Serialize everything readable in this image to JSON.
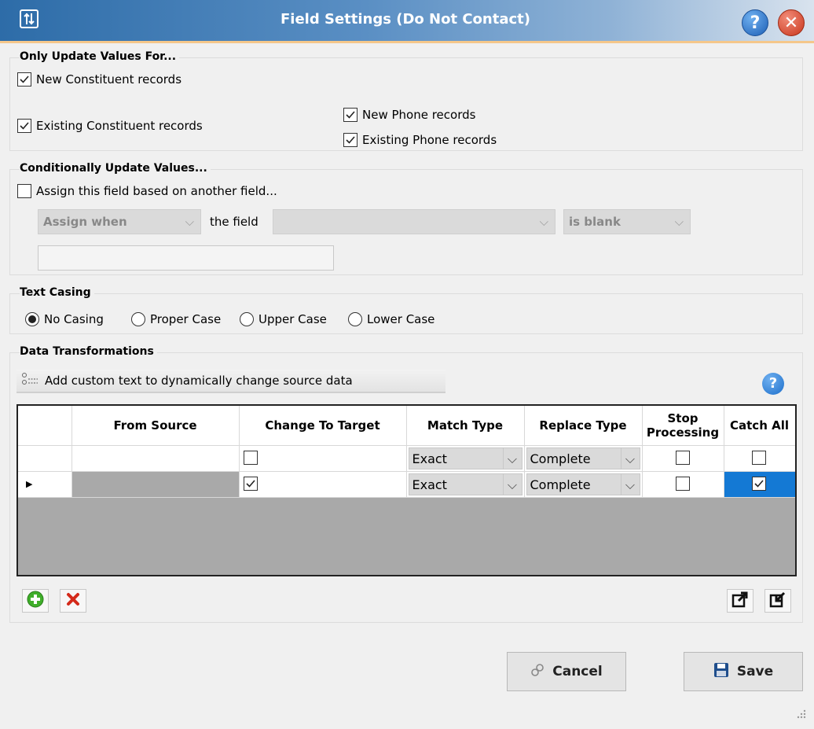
{
  "window": {
    "title": "Field Settings (Do Not Contact)",
    "help_glyph": "?",
    "close_glyph": "✕"
  },
  "update_values": {
    "title": "Only Update Values For...",
    "new_constituent": {
      "label": "New Constituent records",
      "checked": true
    },
    "existing_constituent": {
      "label": "Existing Constituent records",
      "checked": true
    },
    "new_phone": {
      "label": "New Phone records",
      "checked": true
    },
    "existing_phone": {
      "label": "Existing Phone records",
      "checked": true
    }
  },
  "conditional": {
    "title": "Conditionally Update Values...",
    "assign_checkbox": {
      "label": "Assign this field based on another field...",
      "checked": false
    },
    "assign_when": "Assign when",
    "the_field_label": "the field",
    "field_value": "",
    "condition": "is blank",
    "value_input": ""
  },
  "text_casing": {
    "title": "Text Casing",
    "options": [
      {
        "label": "No Casing",
        "selected": true
      },
      {
        "label": "Proper Case",
        "selected": false
      },
      {
        "label": "Upper Case",
        "selected": false
      },
      {
        "label": "Lower Case",
        "selected": false
      }
    ]
  },
  "data_transformations": {
    "title": "Data Transformations",
    "add_custom_text": "Add custom text to dynamically change source data",
    "help_glyph": "?",
    "columns": [
      "",
      "From Source",
      "Change To Target",
      "Match Type",
      "Replace Type",
      "Stop Processing",
      "Catch All"
    ],
    "rows": [
      {
        "indicator": "",
        "from_source": "",
        "change_to_target": false,
        "match_type": "Exact",
        "replace_type": "Complete",
        "stop_processing": false,
        "catch_all": false
      },
      {
        "indicator": "▶",
        "from_source": "",
        "change_to_target": true,
        "match_type": "Exact",
        "replace_type": "Complete",
        "stop_processing": false,
        "catch_all": true
      }
    ]
  },
  "footer": {
    "cancel_label": "Cancel",
    "save_label": "Save"
  },
  "colors": {
    "title_bar": "#2d6ca8",
    "selected_cell": "#1479d4",
    "grid_empty": "#a9a9a9"
  }
}
